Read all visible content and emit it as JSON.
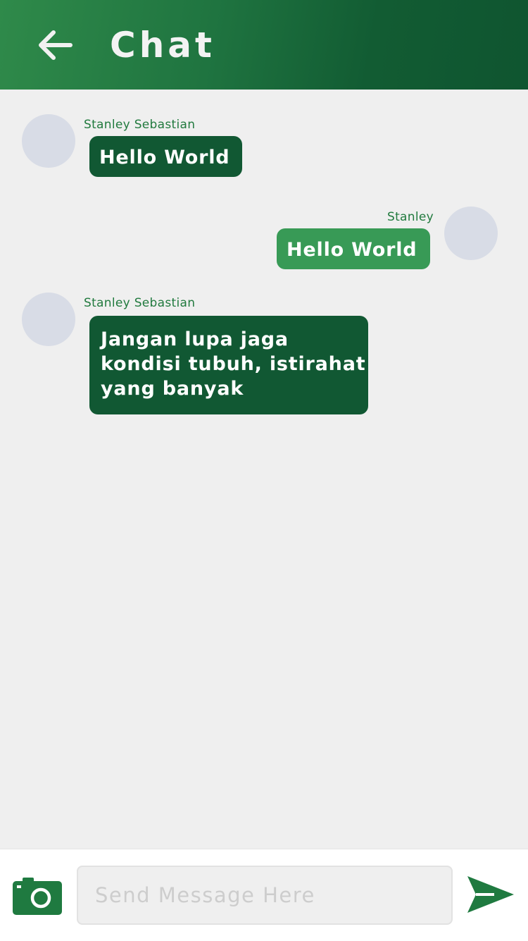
{
  "header": {
    "title": "Chat",
    "back_icon": "arrow-left-icon"
  },
  "messages": [
    {
      "sender": "Stanley Sebastian",
      "text": "Hello World",
      "direction": "incoming"
    },
    {
      "sender": "Stanley",
      "text": "Hello World",
      "direction": "outgoing"
    },
    {
      "sender": "Stanley Sebastian",
      "text_lines": [
        "Jangan lupa jaga",
        "kondisi tubuh, istirahat",
        "yang banyak"
      ],
      "direction": "incoming"
    }
  ],
  "composer": {
    "placeholder": "Send Message Here",
    "camera_icon": "camera-icon",
    "send_icon": "send-icon"
  },
  "colors": {
    "header_gradient_start": "#2f8a4a",
    "header_gradient_end": "#0f5530",
    "incoming_bubble": "#115833",
    "outgoing_bubble": "#389a56",
    "sender_name": "#217a3e",
    "avatar_placeholder": "#d8dce6",
    "background": "#efefef",
    "accent": "#1f7a40"
  }
}
